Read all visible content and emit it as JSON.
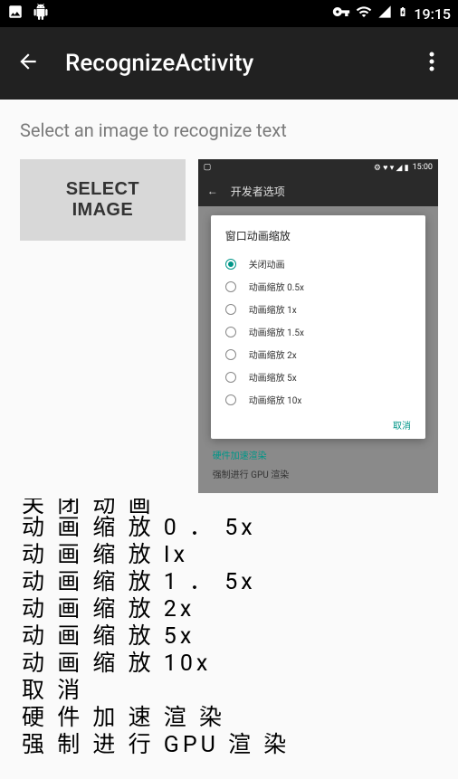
{
  "status_bar": {
    "time": "19:15"
  },
  "action_bar": {
    "title": "RecognizeActivity"
  },
  "prompt": "Select an image to recognize text",
  "select_button": "SELECT IMAGE",
  "preview": {
    "status_time": "15:00",
    "action_title": "开发者选项",
    "dialog_title": "窗口动画缩放",
    "options": [
      "关闭动画",
      "动画缩放 0.5x",
      "动画缩放 1x",
      "动画缩放 1.5x",
      "动画缩放 2x",
      "动画缩放 5x",
      "动画缩放 10x"
    ],
    "selected_index": 0,
    "cancel": "取消",
    "hw_accel": "硬件加速渲染",
    "force_gpu": "强制进行 GPU 渲染"
  },
  "ocr": {
    "lines": [
      "关 闭 动 画",
      "动 画 缩 放 0 ．  5x",
      "动 画 缩 放 Ix",
      "动 画 缩 放 1 ．  5x",
      "动 画 缩 放 2x",
      "动 画 缩 放 5x",
      "动 画 缩 放 10x",
      "取 消",
      "硬 件 加 速 渲 染",
      "强 制 进 行 GPU 渲 染"
    ]
  }
}
